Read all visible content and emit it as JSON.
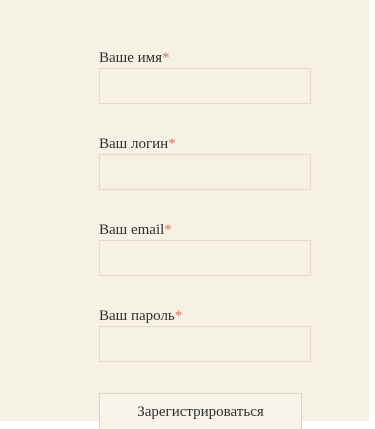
{
  "form": {
    "required_marker": "*",
    "fields": [
      {
        "label": "Ваше имя",
        "value": ""
      },
      {
        "label": "Ваш логин",
        "value": ""
      },
      {
        "label": "Ваш email",
        "value": ""
      },
      {
        "label": "Ваш пароль",
        "value": ""
      }
    ],
    "submit_label": "Зарегистрироваться"
  },
  "colors": {
    "background": "#f5f2e5",
    "required_marker": "#e07066",
    "input_border": "#e2dcc5"
  }
}
